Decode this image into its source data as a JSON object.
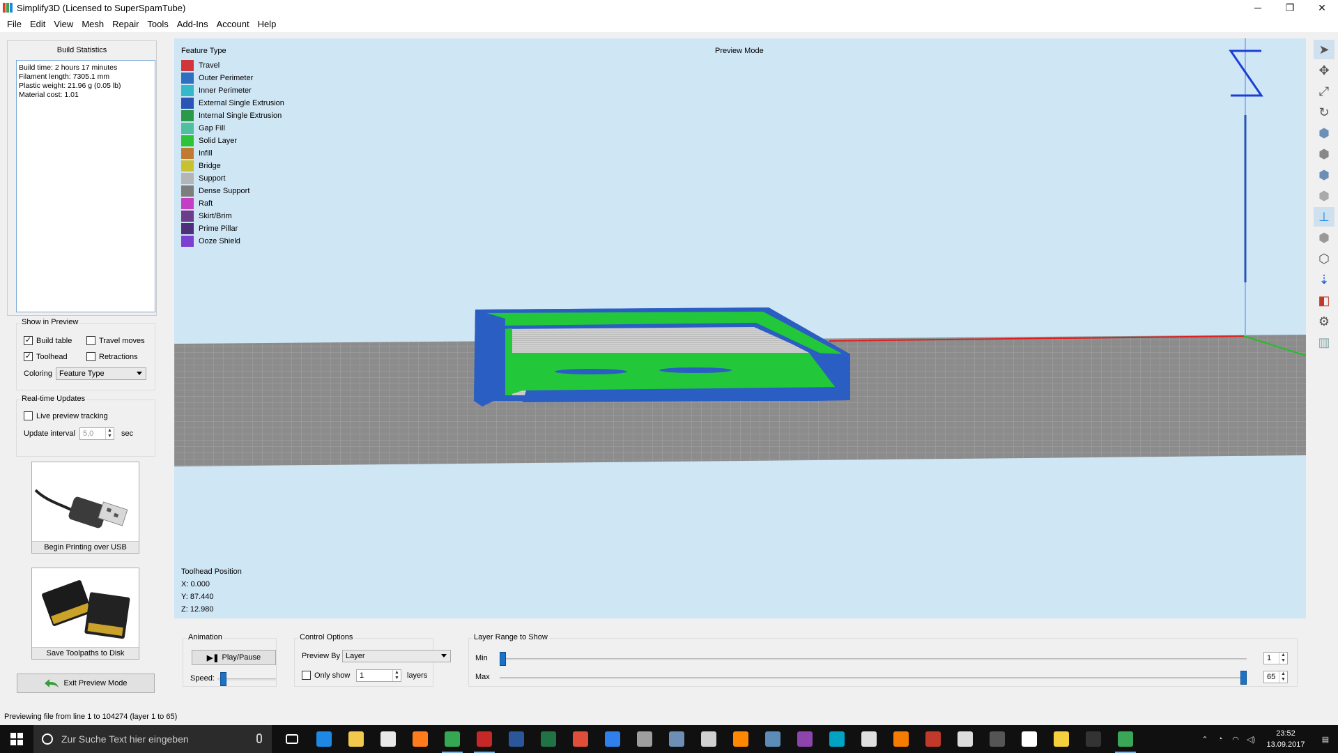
{
  "window": {
    "title": "Simplify3D (Licensed to SuperSpamTube)",
    "controls": {
      "minimize": "─",
      "maximize": "❐",
      "close": "✕"
    }
  },
  "menu": [
    "File",
    "Edit",
    "View",
    "Mesh",
    "Repair",
    "Tools",
    "Add-Ins",
    "Account",
    "Help"
  ],
  "left_panel": {
    "build_statistics": {
      "title": "Build Statistics",
      "lines": [
        "Build time: 2 hours 17 minutes",
        "Filament length: 7305.1 mm",
        "Plastic weight: 21.96 g (0.05 lb)",
        "Material cost: 1.01"
      ]
    },
    "show_in_preview": {
      "title": "Show in Preview",
      "build_table": {
        "label": "Build table",
        "checked": true
      },
      "travel_moves": {
        "label": "Travel moves",
        "checked": false
      },
      "toolhead": {
        "label": "Toolhead",
        "checked": true
      },
      "retractions": {
        "label": "Retractions",
        "checked": false
      },
      "coloring_label": "Coloring",
      "coloring_value": "Feature Type"
    },
    "realtime_updates": {
      "title": "Real-time Updates",
      "live_tracking": {
        "label": "Live preview tracking",
        "checked": false
      },
      "interval_label": "Update interval",
      "interval_value": "5,0",
      "interval_unit": "sec"
    },
    "usb_button": "Begin Printing over USB",
    "disk_button": "Save Toolpaths to Disk",
    "exit_button": "Exit Preview Mode"
  },
  "viewport": {
    "feature_type_title": "Feature Type",
    "preview_mode": "Preview Mode",
    "legend": [
      {
        "label": "Travel",
        "color": "#d0373d"
      },
      {
        "label": "Outer Perimeter",
        "color": "#2e6fc2"
      },
      {
        "label": "Inner Perimeter",
        "color": "#35b8c8"
      },
      {
        "label": "External Single Extrusion",
        "color": "#2a54b5"
      },
      {
        "label": "Internal Single Extrusion",
        "color": "#2b9a48"
      },
      {
        "label": "Gap Fill",
        "color": "#4fbfa0"
      },
      {
        "label": "Solid Layer",
        "color": "#2ec43a"
      },
      {
        "label": "Infill",
        "color": "#c07a32"
      },
      {
        "label": "Bridge",
        "color": "#c8c232"
      },
      {
        "label": "Support",
        "color": "#b5b5b5"
      },
      {
        "label": "Dense Support",
        "color": "#7d7d7d"
      },
      {
        "label": "Raft",
        "color": "#c43fc4"
      },
      {
        "label": "Skirt/Brim",
        "color": "#6b3d8a"
      },
      {
        "label": "Prime Pillar",
        "color": "#4e2f7a"
      },
      {
        "label": "Ooze Shield",
        "color": "#7c3fd0"
      }
    ],
    "toolhead_position": {
      "title": "Toolhead Position",
      "x": "X: 0.000",
      "y": "Y: 87.440",
      "z": "Z: 12.980"
    }
  },
  "toolbar_icons": [
    "select-icon",
    "move-icon",
    "scale-icon",
    "rotate-icon",
    "view-cube-front-icon",
    "view-cube-top-icon",
    "view-cube-side-icon",
    "view-cube-iso-icon",
    "axes-icon",
    "solid-view-icon",
    "wireframe-icon",
    "z-axis-icon",
    "cut-view-icon",
    "settings-gear-icon",
    "support-icon"
  ],
  "bottom": {
    "animation": {
      "title": "Animation",
      "play_label": "Play/Pause",
      "speed_label": "Speed:",
      "speed_fraction": 0.1
    },
    "control_options": {
      "title": "Control Options",
      "preview_by_label": "Preview By",
      "preview_by_value": "Layer",
      "only_show_label": "Only show",
      "only_show_checked": false,
      "only_show_value": "1",
      "layers_label": "layers"
    },
    "layer_range": {
      "title": "Layer Range to Show",
      "min_label": "Min",
      "max_label": "Max",
      "min_value": "1",
      "max_value": "65",
      "min_fraction": 0.0,
      "max_fraction": 1.0
    }
  },
  "status": "Previewing file from line 1 to 104274 (layer 1 to 65)",
  "taskbar": {
    "search_placeholder": "Zur Suche Text hier eingeben",
    "time": "23:52",
    "date": "13.09.2017",
    "apps": [
      {
        "name": "task-view-icon",
        "color": "#ffffff"
      },
      {
        "name": "edge-icon",
        "color": "#1e88e5"
      },
      {
        "name": "explorer-icon",
        "color": "#f2c94c"
      },
      {
        "name": "store-icon",
        "color": "#e8e8e8"
      },
      {
        "name": "firefox-icon",
        "color": "#ff7b1c"
      },
      {
        "name": "chrome-icon",
        "color": "#34a853"
      },
      {
        "name": "app-red-icon",
        "color": "#c62828"
      },
      {
        "name": "word-icon",
        "color": "#2b579a"
      },
      {
        "name": "excel-icon",
        "color": "#217346"
      },
      {
        "name": "acrobat-icon",
        "color": "#e04e39"
      },
      {
        "name": "app-blue-icon",
        "color": "#2f80ed"
      },
      {
        "name": "app-gun-icon",
        "color": "#9e9e9e"
      },
      {
        "name": "app-photo-icon",
        "color": "#6d8fb5"
      },
      {
        "name": "app-cloud-icon",
        "color": "#d0d0d0"
      },
      {
        "name": "vlc-icon",
        "color": "#ff8800"
      },
      {
        "name": "steam-icon",
        "color": "#5b8db8"
      },
      {
        "name": "app-purple-icon",
        "color": "#8e44ad"
      },
      {
        "name": "app-cyan-icon",
        "color": "#00a3c4"
      },
      {
        "name": "calculator-icon",
        "color": "#e0e0e0"
      },
      {
        "name": "blender-icon",
        "color": "#f57c00"
      },
      {
        "name": "app-red2-icon",
        "color": "#c0392b"
      },
      {
        "name": "app-white-icon",
        "color": "#dddddd"
      },
      {
        "name": "app-dark-icon",
        "color": "#555555"
      },
      {
        "name": "mail-icon",
        "color": "#ffffff"
      },
      {
        "name": "sticky-notes-icon",
        "color": "#f4d03f"
      },
      {
        "name": "terminal-icon",
        "color": "#333333"
      },
      {
        "name": "simplify3d-icon",
        "color": "#3aa757"
      }
    ]
  }
}
